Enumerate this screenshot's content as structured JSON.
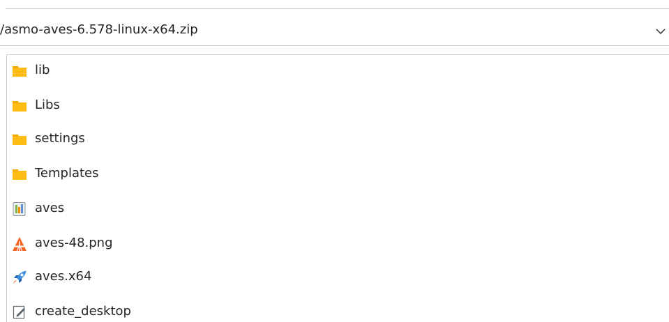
{
  "path_bar": {
    "value": "/asmo-aves-6.578-linux-x64.zip",
    "dropdown_icon": "chevron-down-icon"
  },
  "files": [
    {
      "name": "lib",
      "icon": "folder-icon"
    },
    {
      "name": "Libs",
      "icon": "folder-icon"
    },
    {
      "name": "settings",
      "icon": "folder-icon"
    },
    {
      "name": "Templates",
      "icon": "folder-icon"
    },
    {
      "name": "aves",
      "icon": "application-icon"
    },
    {
      "name": "aves-48.png",
      "icon": "image-file-icon"
    },
    {
      "name": "aves.x64",
      "icon": "executable-rocket-icon"
    },
    {
      "name": "create_desktop",
      "icon": "script-file-icon"
    }
  ],
  "colors": {
    "folder": "#fdbc11",
    "folder_tab": "#f6a800",
    "image_icon": "#f26622",
    "rocket": "#3d8fe0",
    "border": "#c9ccd0",
    "text": "#232629"
  }
}
